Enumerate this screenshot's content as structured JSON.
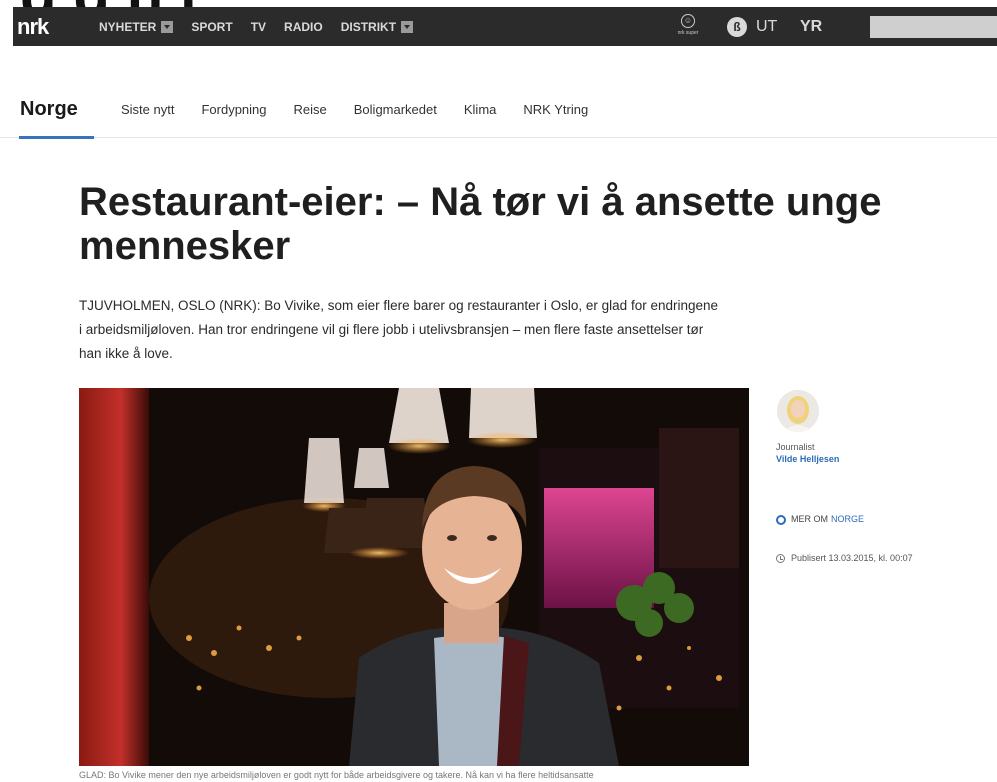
{
  "overlay": {
    "title_fragment": "g  g  n      j"
  },
  "topbar": {
    "logo": "nrk",
    "nav": [
      {
        "label": "NYHETER",
        "dropdown": true
      },
      {
        "label": "SPORT",
        "dropdown": false
      },
      {
        "label": "TV",
        "dropdown": false
      },
      {
        "label": "RADIO",
        "dropdown": false
      },
      {
        "label": "DISTRIKT",
        "dropdown": true
      }
    ],
    "nrk_super_label": "nrk super",
    "p3_label": "ß",
    "ut_label": "UT",
    "yr_label": "YR",
    "search_placeholder": ""
  },
  "section": {
    "title": "Norge",
    "subnav": [
      "Siste nytt",
      "Fordypning",
      "Reise",
      "Boligmarkedet",
      "Klima",
      "NRK Ytring"
    ]
  },
  "article": {
    "headline_line1": "Restaurant-eier: – Nå tør vi å ansette unge",
    "headline_line2": "mennesker",
    "lead": "TJUVHOLMEN, OSLO (NRK): Bo Vivike, som eier flere barer og restauranter i Oslo, er glad for endringene i arbeidsmiljøloven. Han tror endringene vil gi flere jobb i utelivsbransjen – men flere faste ansettelser tør han ikke å love.",
    "caption": "GLAD: Bo Vivike mener den nye arbeidsmiljøloven er godt nytt for både arbeidsgivere og   takere.   Nå kan vi ha flere heltidsansatte"
  },
  "sidebar": {
    "journalist_label": "Journalist",
    "journalist_name": "Vilde Helljesen",
    "mer_om": "MER OM",
    "topic": "NORGE",
    "published": "Publisert 13.03.2015, kl. 00:07"
  },
  "colors": {
    "topbar": "#2b2b2b",
    "accent": "#3774c0",
    "link": "#2e6cb8"
  }
}
